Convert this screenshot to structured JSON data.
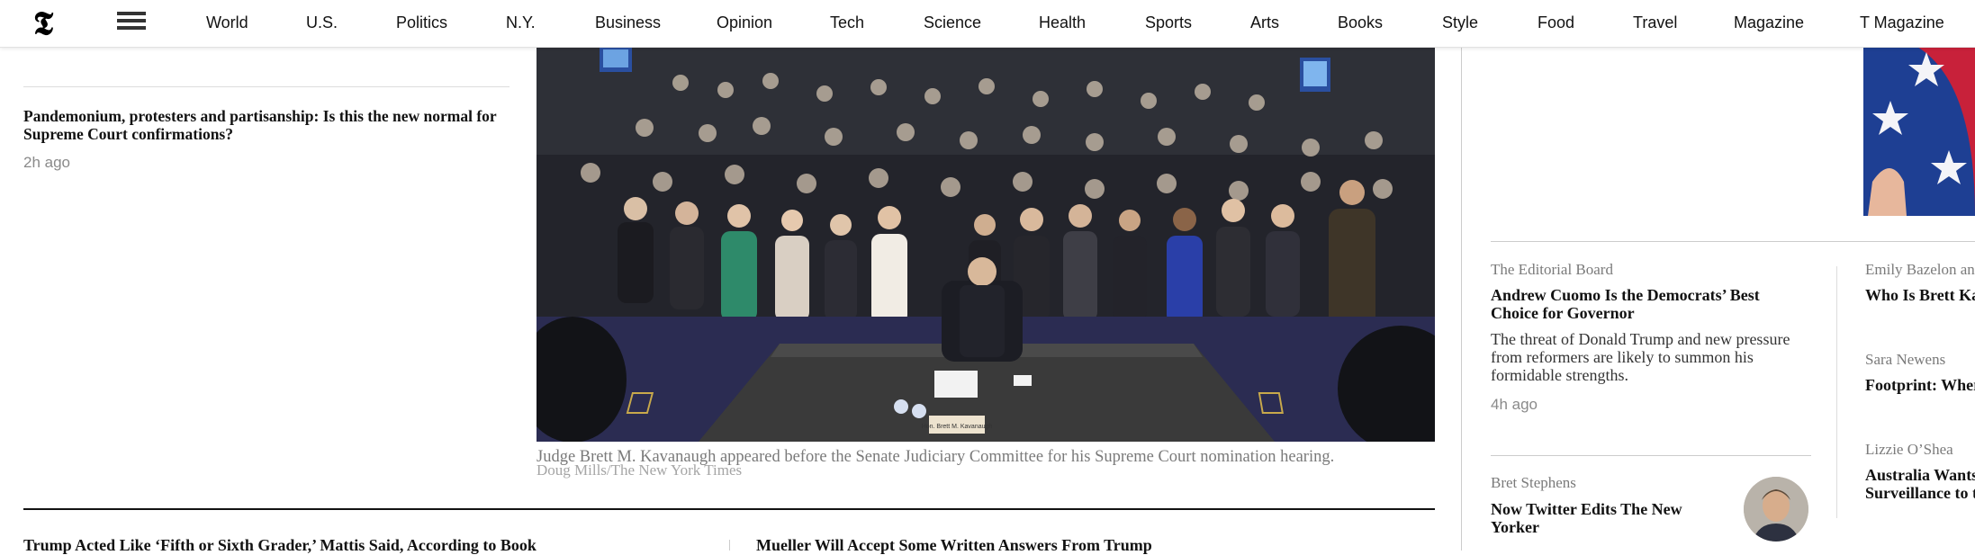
{
  "nav": {
    "logo": "𝕿",
    "items": [
      "World",
      "U.S.",
      "Politics",
      "N.Y.",
      "Business",
      "Opinion",
      "Tech",
      "Science",
      "Health",
      "Sports",
      "Arts",
      "Books",
      "Style",
      "Food",
      "Travel",
      "Magazine",
      "T Magazine"
    ]
  },
  "left_story": {
    "headline": "Pandemonium, protesters and partisanship: Is this the new normal for Supreme Court confirmations?",
    "time": "2h ago"
  },
  "photo": {
    "caption": "Judge Brett M. Kavanaugh appeared before the Senate Judiciary Committee for his Supreme Court nomination hearing.",
    "credit": "Doug Mills/The New York Times",
    "nameplate": "Hon. Brett M. Kavanaugh"
  },
  "bottom_stories": [
    "Trump Acted Like ‘Fifth or Sixth Grader,’ Mattis Said, According to Book",
    "Mueller Will Accept Some Written Answers From Trump"
  ],
  "opinion": [
    {
      "author": "The Editorial Board",
      "headline": "Andrew Cuomo Is the Democrats’ Best Choice for Governor",
      "summary": "The threat of Donald Trump and new pressure from reformers are likely to summon his formidable strengths.",
      "time": "4h ago"
    },
    {
      "author": "Bret Stephens",
      "headline": "Now Twitter Edits The New Yorker"
    }
  ],
  "opinion_right": [
    {
      "author": "Emily Bazelon an",
      "headline": "Who Is Brett Kav"
    },
    {
      "author": "Sara Newens",
      "headline": "Footprint: Wher"
    },
    {
      "author": "Lizzie O’Shea",
      "headline": "Australia Wants",
      "headline2": "Surveillance to t"
    }
  ],
  "colors": {
    "text": "#121212",
    "meta": "#8a8a8a",
    "rule": "#cccccc"
  }
}
